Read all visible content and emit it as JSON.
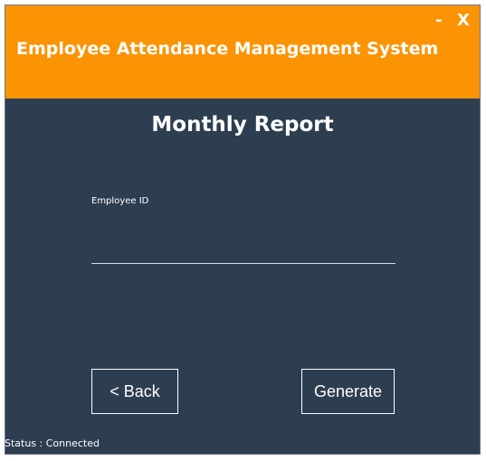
{
  "window": {
    "title": "Employee Attendance Management System",
    "minimize_label": "-",
    "close_label": "X"
  },
  "main": {
    "page_title": "Monthly Report",
    "employee_id_label": "Employee ID",
    "employee_id_value": "",
    "back_label": "< Back",
    "generate_label": "Generate"
  },
  "status": {
    "text": "Status : Connected"
  },
  "colors": {
    "header": "#fb9404",
    "background": "#2e3e51",
    "text": "#ffffff"
  }
}
